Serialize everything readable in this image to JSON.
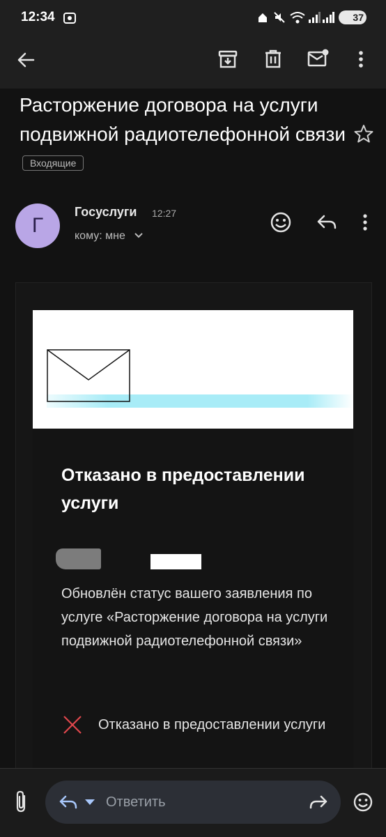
{
  "status_bar": {
    "time": "12:34",
    "battery": "37"
  },
  "toolbar": {
    "back_icon": "arrow-left-icon",
    "archive_icon": "archive-icon",
    "delete_icon": "trash-icon",
    "mark_unread_icon": "mail-unread-icon",
    "more_icon": "more-vert-icon"
  },
  "email": {
    "subject": "Расторжение договора на услуги подвижной радиотелефонной связи",
    "label": "Входящие",
    "sender_initial": "Г",
    "sender": "Госуслуги",
    "time": "12:27",
    "recipient": "кому: мне"
  },
  "message": {
    "heading": "Отказано в предоставлении услуги",
    "paragraph": "Обновлён статус вашего заявления по услуге «Расторжение договора на услуги подвижной радиотелефонной связи»",
    "status_text": "Отказано в предоставлении услуги",
    "status_icon_color": "#e0474c"
  },
  "reply_bar": {
    "placeholder": "Ответить"
  },
  "colors": {
    "background": "#121212",
    "banner_accent": "#a8ecf7",
    "avatar": "#b9a6e6"
  }
}
